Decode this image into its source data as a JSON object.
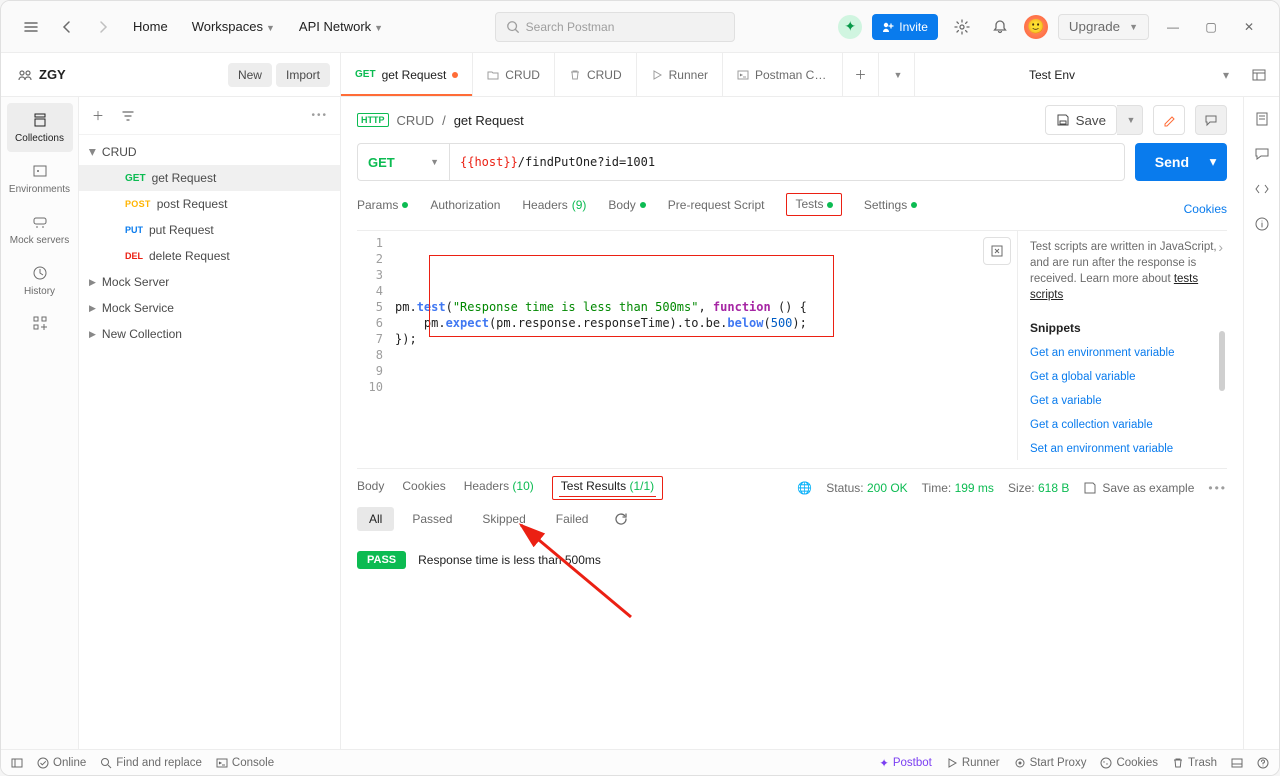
{
  "topbar": {
    "home": "Home",
    "workspaces": "Workspaces",
    "api_network": "API Network",
    "search_placeholder": "Search Postman",
    "invite": "Invite",
    "upgrade": "Upgrade"
  },
  "workspace": {
    "name": "ZGY",
    "new_btn": "New",
    "import_btn": "Import"
  },
  "rail": {
    "collections": "Collections",
    "environments": "Environments",
    "mock_servers": "Mock servers",
    "history": "History"
  },
  "tabs": [
    {
      "method": "GET",
      "label": "get Request",
      "dirty": true,
      "icon": "get"
    },
    {
      "label": "CRUD",
      "icon": "folder"
    },
    {
      "label": "CRUD",
      "icon": "trash"
    },
    {
      "label": "Runner",
      "icon": "runner"
    },
    {
      "label": "Postman CLI Configu",
      "icon": "cli"
    }
  ],
  "env": {
    "name": "Test Env"
  },
  "explorer": {
    "root": "CRUD",
    "items": [
      {
        "method": "GET",
        "label": "get Request"
      },
      {
        "method": "POST",
        "label": "post Request"
      },
      {
        "method": "PUT",
        "label": "put Request"
      },
      {
        "method": "DEL",
        "label": "delete Request"
      }
    ],
    "others": [
      "Mock Server",
      "Mock Service",
      "New Collection"
    ]
  },
  "breadcrumb": {
    "folder": "CRUD",
    "name": "get Request",
    "save": "Save"
  },
  "request": {
    "method": "GET",
    "url_var": "{{host}}",
    "url_rest": "/findPutOne?id=1001",
    "send": "Send"
  },
  "req_tabs": {
    "params": "Params",
    "auth": "Authorization",
    "headers": "Headers",
    "headers_count": "(9)",
    "body": "Body",
    "prereq": "Pre-request Script",
    "tests": "Tests",
    "settings": "Settings",
    "cookies": "Cookies"
  },
  "code": {
    "l3a": "pm.",
    "l3b": "test",
    "l3c": "(",
    "l3d": "\"Response time is less than 500ms\"",
    "l3e": ", ",
    "l3f": "function",
    "l3g": " () {",
    "l4a": "    pm.",
    "l4b": "expect",
    "l4c": "(pm.response.responseTime).to.be.",
    "l4d": "below",
    "l4e": "(",
    "l4f": "500",
    "l4g": ");",
    "l5": "});"
  },
  "snippets": {
    "desc1": "Test scripts are written in JavaScript, and are run after the response is received. Learn more about ",
    "desc_link": "tests scripts",
    "heading": "Snippets",
    "links": [
      "Get an environment variable",
      "Get a global variable",
      "Get a variable",
      "Get a collection variable",
      "Set an environment variable"
    ]
  },
  "resp_tabs": {
    "body": "Body",
    "cookies": "Cookies",
    "headers": "Headers",
    "headers_count": "(10)",
    "test_results": "Test Results",
    "test_results_count": "(1/1)"
  },
  "status": {
    "status_lbl": "Status:",
    "status_val": "200 OK",
    "time_lbl": "Time:",
    "time_val": "199 ms",
    "size_lbl": "Size:",
    "size_val": "618 B",
    "save_example": "Save as example"
  },
  "filters": {
    "all": "All",
    "passed": "Passed",
    "skipped": "Skipped",
    "failed": "Failed"
  },
  "result": {
    "badge": "PASS",
    "msg": "Response time is less than 500ms"
  },
  "footer": {
    "online": "Online",
    "find": "Find and replace",
    "console": "Console",
    "postbot": "Postbot",
    "runner": "Runner",
    "startproxy": "Start Proxy",
    "cookies": "Cookies",
    "trash": "Trash"
  }
}
